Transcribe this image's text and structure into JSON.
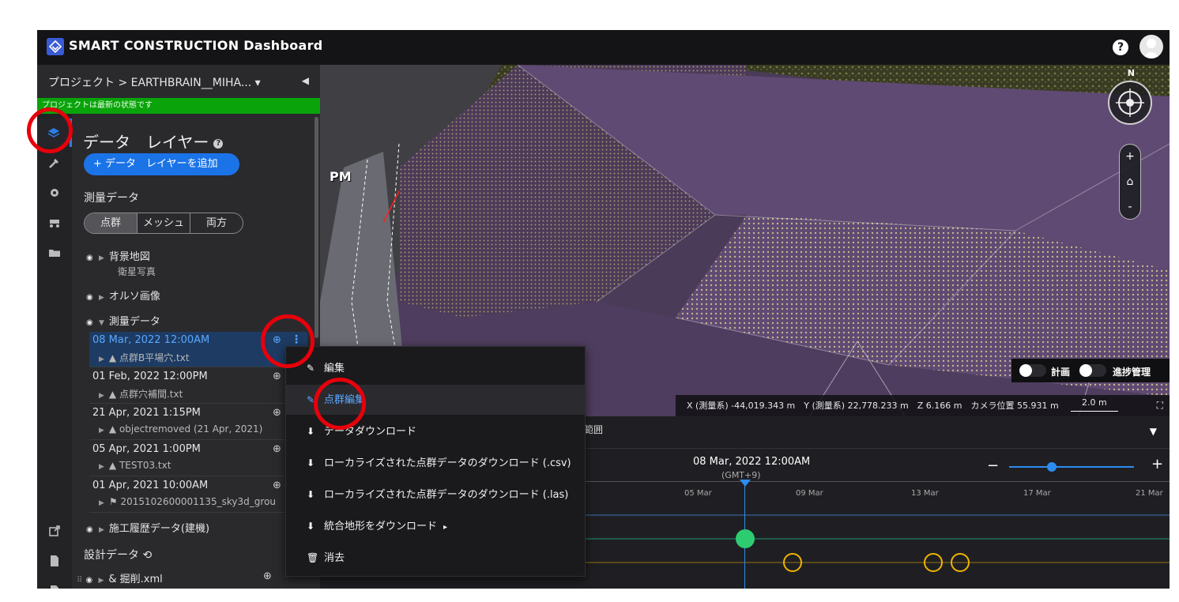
{
  "app": {
    "title": "SMART CONSTRUCTION Dashboard",
    "help_label": "?"
  },
  "project": {
    "breadcrumb": "プロジェクト > EARTHBRAIN__MIHA... ▾",
    "collapse_label": "◀",
    "status": "プロジェクトは最新の状態です"
  },
  "panel": {
    "title": "データ　レイヤー",
    "help": "?",
    "add_button": "+ データ　レイヤーを追加",
    "survey_section": "測量データ",
    "segments": [
      "点群",
      "メッシュ",
      "両方"
    ],
    "active_segment": "点群",
    "layers": [
      {
        "name": "背景地図",
        "sub": "衛星写真"
      },
      {
        "name": "オルソ画像",
        "sub": ""
      },
      {
        "name": "測量データ",
        "sub": ""
      }
    ],
    "survey_items": [
      {
        "date": "08 Mar, 2022 12:00AM",
        "file": "▲ 点群B平場穴.txt",
        "selected": true
      },
      {
        "date": "01 Feb, 2022 12:00PM",
        "file": "▲ 点群穴補間.txt",
        "selected": false
      },
      {
        "date": "21 Apr, 2021 1:15PM",
        "file": "▲ objectremoved (21 Apr, 2021)",
        "selected": false
      },
      {
        "date": "05 Apr, 2021 1:00PM",
        "file": "▲ TEST03.txt",
        "selected": false
      },
      {
        "date": "01 Apr, 2021 10:00AM",
        "file": "⚑ 20151026000011​35_sky3d_grou",
        "selected": false
      }
    ],
    "machine_history": "施工履歴データ(建機)",
    "design_section": "設計データ",
    "design_items": [
      {
        "name": "& 掘削.xml"
      }
    ]
  },
  "map": {
    "north": "N",
    "label_pm": "PM",
    "toggle_plan": "計画",
    "toggle_progress": "進捗管理",
    "coords": "X (測量系) -44,019.343 m　Y (測量系) 22,778.233 m　Z 6.166 m　カメラ位置 55.931 m",
    "scale": "2.0 m",
    "zoom_in": "+",
    "zoom_out": "-"
  },
  "timeline": {
    "tab": "範囲",
    "current_date": "08 Mar, 2022 12:00AM",
    "tz": "(GMT+9)",
    "ticks": [
      "05 Mar",
      "09 Mar",
      "13 Mar",
      "17 Mar",
      "21 Mar"
    ],
    "zoom_minus": "−",
    "zoom_plus": "+",
    "zoom_level": 0.34
  },
  "context_menu": {
    "items": [
      {
        "label": "編集",
        "icon": "pencil-icon",
        "highlighted": false
      },
      {
        "label": "点群編集",
        "icon": "pencil-icon",
        "highlighted": true
      },
      {
        "label": "データダウンロード",
        "icon": "download-file-icon",
        "highlighted": false
      },
      {
        "label": "ローカライズされた点群データのダウンロード (.csv)",
        "icon": "download-file-icon",
        "highlighted": false
      },
      {
        "label": "ローカライズされた点群データのダウンロード (.las)",
        "icon": "download-file-icon",
        "highlighted": false
      },
      {
        "label": "統合地形をダウンロード",
        "icon": "download-file-icon",
        "highlighted": false,
        "submenu": "▸"
      },
      {
        "label": "消去",
        "icon": "trash-icon",
        "highlighted": false
      }
    ]
  },
  "colors": {
    "accent": "#1b73e8",
    "status_green": "#0aa30a",
    "highlight_red": "#e8000b",
    "selected_blue": "#5aa8ff"
  }
}
